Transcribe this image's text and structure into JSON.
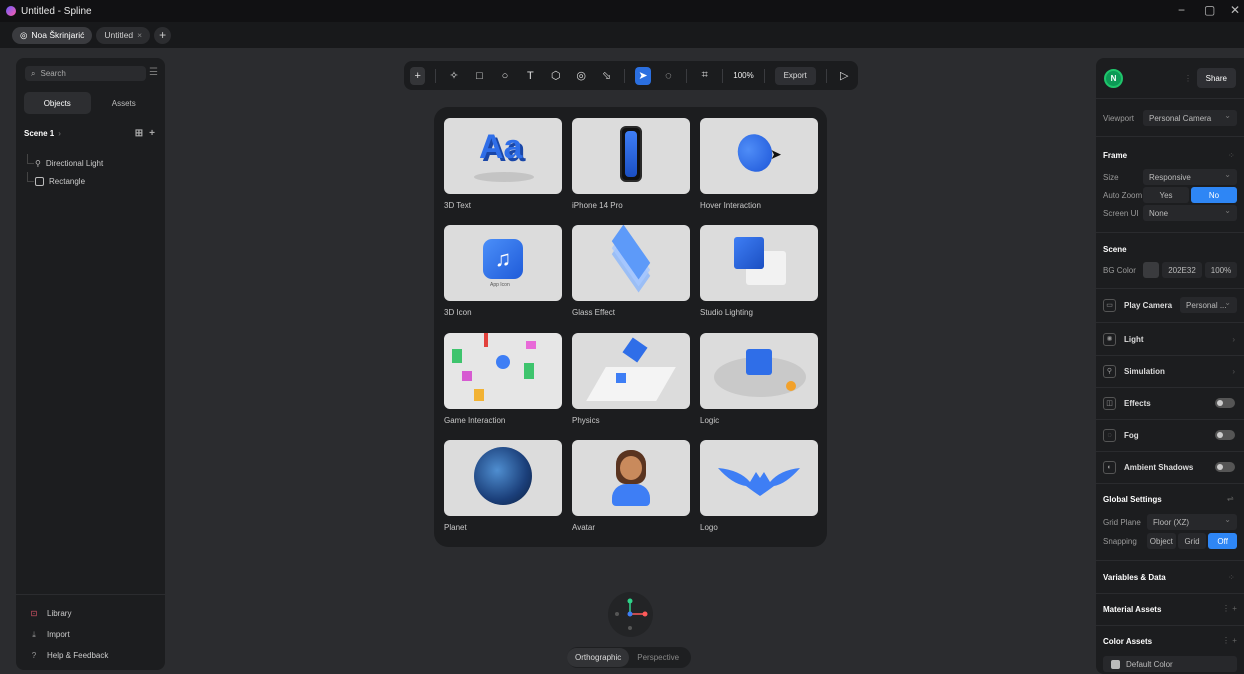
{
  "window": {
    "title": "Untitled - Spline"
  },
  "tabs": {
    "user": "Noa Škrinjarić",
    "doc": "Untitled",
    "add": "+"
  },
  "left": {
    "search": "Search",
    "tabs": [
      "Objects",
      "Assets"
    ],
    "scene": "Scene 1",
    "tree": [
      "Directional Light",
      "Rectangle"
    ],
    "footer": [
      "Library",
      "Import",
      "Help & Feedback"
    ]
  },
  "toolbar": {
    "zoom": "100%",
    "export": "Export"
  },
  "gallery": [
    {
      "label": "3D Text"
    },
    {
      "label": "iPhone 14 Pro"
    },
    {
      "label": "Hover Interaction"
    },
    {
      "label": "3D Icon",
      "sub": "App Icon"
    },
    {
      "label": "Glass Effect"
    },
    {
      "label": "Studio Lighting"
    },
    {
      "label": "Game Interaction"
    },
    {
      "label": "Physics"
    },
    {
      "label": "Logic"
    },
    {
      "label": "Planet"
    },
    {
      "label": "Avatar"
    },
    {
      "label": "Logo"
    }
  ],
  "projection": {
    "on": "Orthographic",
    "off": "Perspective"
  },
  "right": {
    "avatar": "N",
    "share": "Share",
    "viewport_label": "Viewport",
    "viewport": "Personal Camera",
    "frame": "Frame",
    "size_label": "Size",
    "size": "Responsive",
    "autozoom_label": "Auto Zoom",
    "autozoom_yes": "Yes",
    "autozoom_no": "No",
    "screenui_label": "Screen UI",
    "screenui": "None",
    "scene": "Scene",
    "bg_label": "BG Color",
    "bg_hex": "202E32",
    "bg_pct": "100%",
    "playcam": "Play Camera",
    "playcam_val": "Personal ...",
    "light": "Light",
    "simulation": "Simulation",
    "effects": "Effects",
    "fog": "Fog",
    "ambient": "Ambient Shadows",
    "global": "Global Settings",
    "gridplane_label": "Grid Plane",
    "gridplane": "Floor (XZ)",
    "snapping_label": "Snapping",
    "snap_object": "Object",
    "snap_grid": "Grid",
    "snap_off": "Off",
    "variables": "Variables & Data",
    "material": "Material Assets",
    "color": "Color Assets",
    "default_color": "Default Color"
  }
}
